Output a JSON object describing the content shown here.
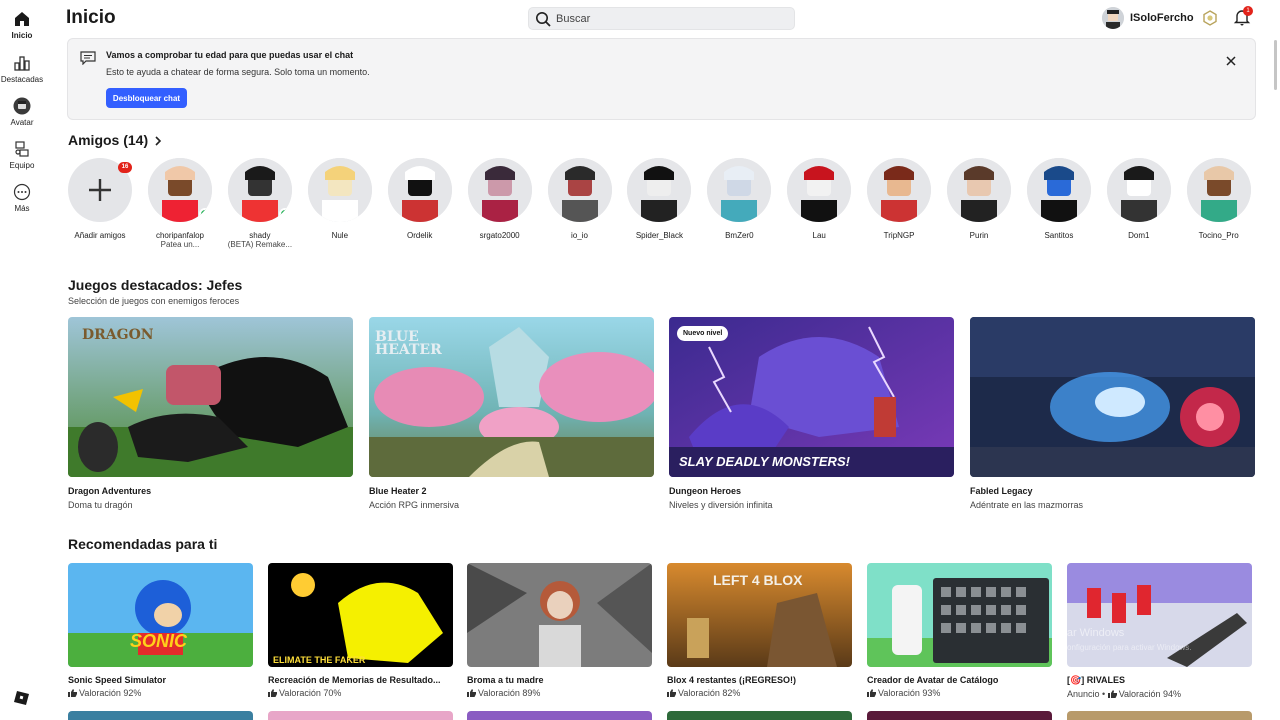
{
  "nav": {
    "items": [
      {
        "label": "Inicio",
        "icon": "home-icon"
      },
      {
        "label": "Destacadas",
        "icon": "charts-icon"
      },
      {
        "label": "Avatar",
        "icon": "avatar-icon"
      },
      {
        "label": "Equipo",
        "icon": "inventory-icon"
      },
      {
        "label": "Más",
        "icon": "more-icon"
      }
    ],
    "logo_icon": "roblox-logo-icon"
  },
  "header": {
    "title": "Inicio",
    "search_placeholder": "Buscar",
    "username": "ISoloFercho",
    "notification_count": "1"
  },
  "banner": {
    "title": "Vamos a comprobar tu edad para que puedas usar el chat",
    "text": "Esto te ayuda a chatear de forma segura. Solo toma un momento.",
    "button": "Desbloquear chat"
  },
  "friends": {
    "title": "Amigos (14)",
    "add_label": "Añadir amigos",
    "add_badge": "16",
    "list": [
      {
        "name": "choripanfalop",
        "status": "Patea un...",
        "online": true
      },
      {
        "name": "shady",
        "status": "(BETA) Remake...",
        "online": true
      },
      {
        "name": "Nule",
        "status": ""
      },
      {
        "name": "Ordelik",
        "status": ""
      },
      {
        "name": "srgato2000",
        "status": ""
      },
      {
        "name": "io_io",
        "status": ""
      },
      {
        "name": "Spider_Black",
        "status": ""
      },
      {
        "name": "BmZer0",
        "status": ""
      },
      {
        "name": "Lau",
        "status": ""
      },
      {
        "name": "TripNGP",
        "status": ""
      },
      {
        "name": "Purin",
        "status": ""
      },
      {
        "name": "Santitos",
        "status": ""
      },
      {
        "name": "Dom1",
        "status": ""
      },
      {
        "name": "Tocino_Pro",
        "status": ""
      }
    ]
  },
  "featured": {
    "title": "Juegos destacados: Jefes",
    "subtitle": "Selección de juegos con enemigos feroces",
    "games": [
      {
        "title": "Dragon Adventures",
        "sub": "Doma tu dragón",
        "thumb_text": "DRAGON",
        "pill": ""
      },
      {
        "title": "Blue Heater 2",
        "sub": "Acción RPG inmersiva",
        "thumb_text": "BLUE HEATER",
        "pill": ""
      },
      {
        "title": "Dungeon Heroes",
        "sub": "Niveles y diversión infinita",
        "thumb_text": "SLAY DEADLY MONSTERS!",
        "pill": "Nuevo nivel"
      },
      {
        "title": "Fabled Legacy",
        "sub": "Adéntrate en las mazmorras",
        "thumb_text": "",
        "pill": ""
      }
    ]
  },
  "recommended": {
    "title": "Recomendadas para ti",
    "games": [
      {
        "title": "Sonic Speed Simulator",
        "rating": "Valoración 92%",
        "prefix": "",
        "thumb_text": "SONIC"
      },
      {
        "title": "Recreación de Memorias de Resultado...",
        "rating": "Valoración 70%",
        "prefix": "",
        "thumb_text": "ELIMATE THE FAKER"
      },
      {
        "title": "Broma a tu madre",
        "rating": "Valoración 89%",
        "prefix": "",
        "thumb_text": ""
      },
      {
        "title": "Blox 4 restantes (¡REGRESO!)",
        "rating": "Valoración 82%",
        "prefix": "",
        "thumb_text": "LEFT 4 BLOX"
      },
      {
        "title": "Creador de Avatar de Catálogo",
        "rating": "Valoración 93%",
        "prefix": "",
        "thumb_text": ""
      },
      {
        "title": "[🎯] RIVALES",
        "rating": "Valoración 94%",
        "prefix": "Anuncio • ",
        "thumb_text": ""
      }
    ]
  },
  "watermark": {
    "line1": "Activar Windows",
    "line2": "Ve a Configuración para activar Windows."
  },
  "colors": {
    "accent": "#335fff",
    "badge": "#e2231a",
    "online": "#2fb55f"
  }
}
